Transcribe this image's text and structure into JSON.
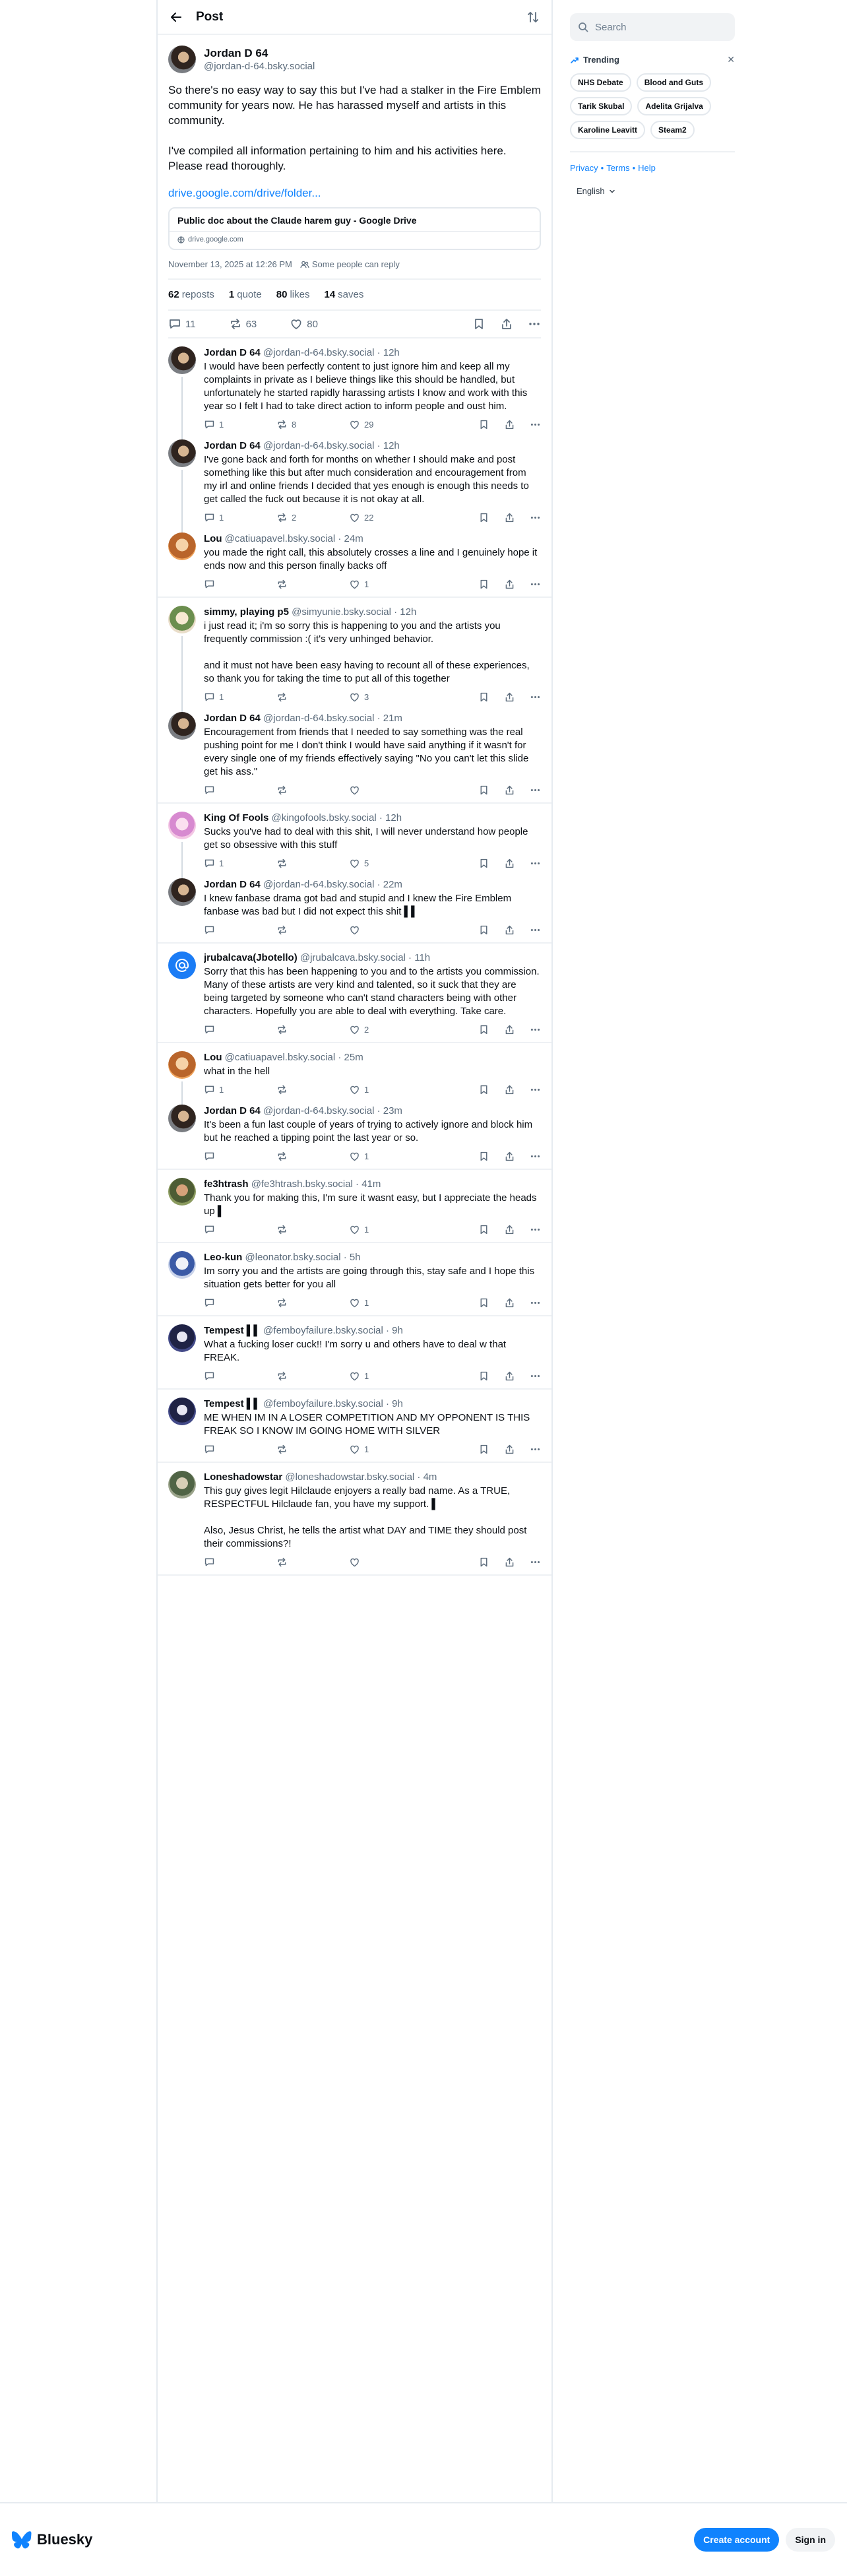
{
  "header": {
    "title": "Post"
  },
  "main_post": {
    "author_name": "Jordan D 64",
    "author_handle": "@jordan-d-64.bsky.social",
    "text": "So there's no easy way to say this but I've had a stalker in the Fire Emblem community for years now. He has harassed myself and artists in this community.\n\nI've compiled all information pertaining to him and his activities here. Please read thoroughly.",
    "link": "drive.google.com/drive/folder...",
    "card_title": "Public doc about the Claude harem guy - Google Drive",
    "card_domain": "drive.google.com",
    "timestamp": "November 13, 2025 at 12:26 PM",
    "reply_setting": "Some people can reply",
    "reposts": "62",
    "reposts_label": "reposts",
    "quotes": "1",
    "quotes_label": "quote",
    "likes": "80",
    "likes_label": "likes",
    "saves": "14",
    "saves_label": "saves",
    "reply_count": "11",
    "repost_count": "63",
    "like_count": "80"
  },
  "replies": [
    {
      "name": "Jordan D 64",
      "meta": "@jordan-d-64.bsky.social · 12h",
      "text": "I would have been perfectly content to just ignore him and keep all my complaints in private as I believe things like this should be handled, but unfortunately he started rapidly harassing artists I know and work with this year so I felt I had to take direct action to inform people and oust him.",
      "replies": "1",
      "reposts": "8",
      "likes": "29"
    },
    {
      "name": "Jordan D 64",
      "meta": "@jordan-d-64.bsky.social · 12h",
      "text": "I've gone back and forth for months on whether I should make and post something like this but after much consideration and encouragement from my irl and online friends I decided that yes enough is enough this needs to get called the fuck out because it is not okay at all.",
      "replies": "1",
      "reposts": "2",
      "likes": "22"
    },
    {
      "name": "Lou",
      "meta": "@catiuapavel.bsky.social · 24m",
      "text": "you made the right call, this absolutely crosses a line and I genuinely hope it ends now and this person finally backs off",
      "replies": "",
      "reposts": "",
      "likes": "1"
    },
    {
      "name": "simmy, playing p5",
      "meta": "@simyunie.bsky.social · 12h",
      "text": "i just read it; i'm so sorry this is happening to you and the artists you frequently commission :( it's very unhinged behavior.\n\nand it must not have been easy having to recount all of these experiences, so thank you for taking the time to put all of this together",
      "replies": "1",
      "reposts": "",
      "likes": "3"
    },
    {
      "name": "Jordan D 64",
      "meta": "@jordan-d-64.bsky.social · 21m",
      "text": "Encouragement from friends that I needed to say something was the real pushing point for me I don't think I would have said anything if it wasn't for every single one of my friends effectively saying \"No you can't let this slide get his ass.\"",
      "replies": "",
      "reposts": "",
      "likes": ""
    },
    {
      "name": "King Of Fools",
      "meta": "@kingofools.bsky.social · 12h",
      "text": "Sucks you've had to deal with this shit, I will never understand how people get so obsessive with this stuff",
      "replies": "1",
      "reposts": "",
      "likes": "5"
    },
    {
      "name": "Jordan D 64",
      "meta": "@jordan-d-64.bsky.social · 22m",
      "text": "I knew fanbase drama got bad and stupid and I knew the Fire Emblem fanbase was bad but I did not expect this shit ▌▌",
      "replies": "",
      "reposts": "",
      "likes": ""
    },
    {
      "name": "jrubalcava(Jbotello)",
      "meta": "@jrubalcava.bsky.social · 11h",
      "text": "Sorry that this has been happening to you and to the artists you commission. Many of these artists are very kind and talented, so it suck that they are being targeted by someone who can't stand characters being with other characters. Hopefully you are able to deal with everything. Take care.",
      "replies": "",
      "reposts": "",
      "likes": "2"
    },
    {
      "name": "Lou",
      "meta": "@catiuapavel.bsky.social · 25m",
      "text": "what in the hell",
      "replies": "1",
      "reposts": "",
      "likes": "1"
    },
    {
      "name": "Jordan D 64",
      "meta": "@jordan-d-64.bsky.social · 23m",
      "text": "It's been a fun last couple of years of trying to actively ignore and block him but he reached a tipping point the last year or so.",
      "replies": "",
      "reposts": "",
      "likes": "1"
    },
    {
      "name": "fe3htrash",
      "meta": "@fe3htrash.bsky.social · 41m",
      "text": "Thank you for making this, I'm sure it wasnt easy, but I appreciate the heads up ▌",
      "replies": "",
      "reposts": "",
      "likes": "1"
    },
    {
      "name": "Leo-kun",
      "meta": "@leonator.bsky.social · 5h",
      "text": "Im sorry you and the artists are going through this, stay safe and I hope this situation gets better for you all",
      "replies": "",
      "reposts": "",
      "likes": "1"
    },
    {
      "name": "Tempest ▌▌",
      "meta": "@femboyfailure.bsky.social · 9h",
      "text": "What a fucking loser cuck!! I'm sorry u and others have to deal w that FREAK.",
      "replies": "",
      "reposts": "",
      "likes": "1"
    },
    {
      "name": "Tempest ▌▌",
      "meta": "@femboyfailure.bsky.social · 9h",
      "text": "ME WHEN IM IN A LOSER COMPETITION AND MY OPPONENT IS THIS FREAK SO I KNOW IM GOING HOME WITH SILVER",
      "replies": "",
      "reposts": "",
      "likes": "1"
    },
    {
      "name": "Loneshadowstar",
      "meta": "@loneshadowstar.bsky.social · 4m",
      "text": "This guy gives legit Hilclaude enjoyers a really bad name. As a TRUE, RESPECTFUL Hilclaude fan, you have my support. ▌\n\nAlso, Jesus Christ, he tells the artist what DAY and TIME they should post their commissions?!",
      "replies": "",
      "reposts": "",
      "likes": ""
    }
  ],
  "sidebar": {
    "search_placeholder": "Search",
    "trending_label": "Trending",
    "tags": [
      "NHS Debate",
      "Blood and Guts",
      "Tarik Skubal",
      "Adelita Grijalva",
      "Karoline Leavitt",
      "Steam2"
    ],
    "privacy": "Privacy",
    "terms": "Terms",
    "help": "Help",
    "language": "English"
  },
  "bottom_bar": {
    "brand": "Bluesky",
    "create_account": "Create account",
    "sign_in": "Sign in"
  },
  "colors": {
    "accent": "#1083fe",
    "muted": "#5b6b7b",
    "border": "#eef1f4"
  }
}
